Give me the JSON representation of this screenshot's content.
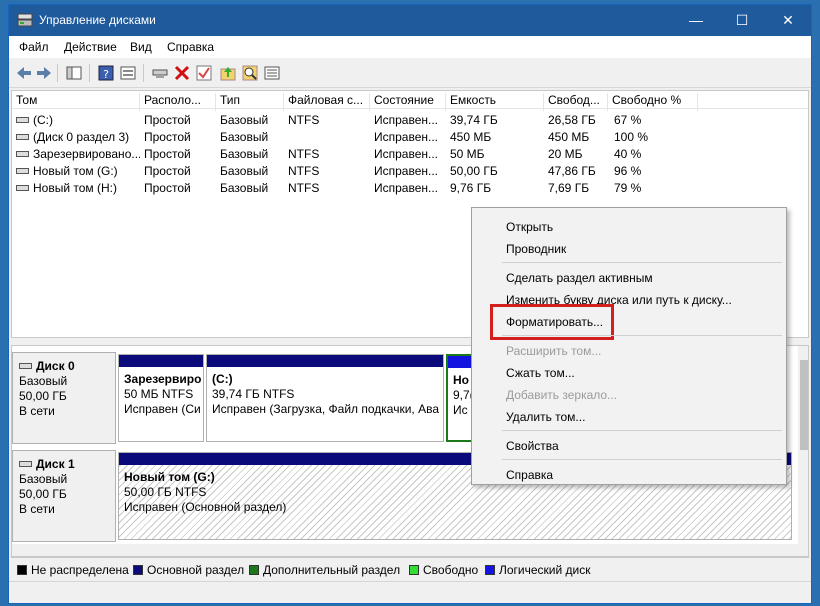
{
  "window": {
    "title": "Управление дисками"
  },
  "window_controls": {
    "minimize": "—",
    "maximize": "☐",
    "close": "✕"
  },
  "menu": [
    "Файл",
    "Действие",
    "Вид",
    "Справка"
  ],
  "toolbar_icons": [
    "back-icon",
    "forward-icon",
    "console-tree-icon",
    "help-icon",
    "properties-icon",
    "connect-icon",
    "delete-icon",
    "check-icon",
    "folder-up-icon",
    "search-icon",
    "list-icon"
  ],
  "volume_table": {
    "columns": [
      "Том",
      "Располо...",
      "Тип",
      "Файловая с...",
      "Состояние",
      "Емкость",
      "Свобод...",
      "Свободно %"
    ],
    "rows": [
      [
        "(C:)",
        "Простой",
        "Базовый",
        "NTFS",
        "Исправен...",
        "39,74 ГБ",
        "26,58 ГБ",
        "67 %"
      ],
      [
        "(Диск 0 раздел 3)",
        "Простой",
        "Базовый",
        "",
        "Исправен...",
        "450 МБ",
        "450 МБ",
        "100 %"
      ],
      [
        "Зарезервировано...",
        "Простой",
        "Базовый",
        "NTFS",
        "Исправен...",
        "50 МБ",
        "20 МБ",
        "40 %"
      ],
      [
        "Новый том (G:)",
        "Простой",
        "Базовый",
        "NTFS",
        "Исправен...",
        "50,00 ГБ",
        "47,86 ГБ",
        "96 %"
      ],
      [
        "Новый том (H:)",
        "Простой",
        "Базовый",
        "NTFS",
        "Исправен...",
        "9,76 ГБ",
        "7,69 ГБ",
        "79 %"
      ]
    ]
  },
  "disks": [
    {
      "name": "Диск 0",
      "type": "Базовый",
      "size": "50,00 ГБ",
      "status": "В сети",
      "partitions": [
        {
          "name": "Зарезервиро",
          "size": "50 МБ NTFS",
          "status": "Исправен (Си"
        },
        {
          "name": "(C:)",
          "size": "39,74 ГБ NTFS",
          "status": "Исправен (Загрузка, Файл подкачки, Ава"
        },
        {
          "name": "Но",
          "size": "9,7(",
          "status": "Ис"
        }
      ]
    },
    {
      "name": "Диск 1",
      "type": "Базовый",
      "size": "50,00 ГБ",
      "status": "В сети",
      "partitions": [
        {
          "name": "Новый том  (G:)",
          "size": "50,00 ГБ NTFS",
          "status": "Исправен (Основной раздел)"
        }
      ]
    }
  ],
  "legend": [
    {
      "label": "Не распределена",
      "color": "#000000"
    },
    {
      "label": "Основной раздел",
      "color": "#0a0a7a"
    },
    {
      "label": "Дополнительный раздел",
      "color": "#1a7a1a"
    },
    {
      "label": "Свободно",
      "color": "#33dd33"
    },
    {
      "label": "Логический диск",
      "color": "#1414e0"
    }
  ],
  "context_menu": {
    "items": [
      {
        "label": "Открыть",
        "enabled": true
      },
      {
        "label": "Проводник",
        "enabled": true
      },
      {
        "label": "Сделать раздел активным",
        "enabled": true
      },
      {
        "label": "Изменить букву диска или путь к диску...",
        "enabled": true
      },
      {
        "label": "Форматировать...",
        "enabled": true,
        "highlighted": true
      },
      {
        "label": "Расширить том...",
        "enabled": false
      },
      {
        "label": "Сжать том...",
        "enabled": true
      },
      {
        "label": "Добавить зеркало...",
        "enabled": false
      },
      {
        "label": "Удалить том...",
        "enabled": true
      },
      {
        "label": "Свойства",
        "enabled": true
      },
      {
        "label": "Справка",
        "enabled": true
      }
    ]
  },
  "colors": {
    "titlebar": "#1e5a9c",
    "primary_partition": "#0a0a7a",
    "extended_partition": "#1a7a1a",
    "logical_drive": "#1414e0",
    "highlight": "#d41f1f"
  }
}
